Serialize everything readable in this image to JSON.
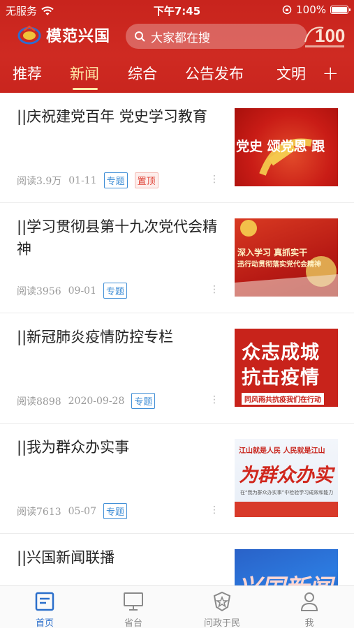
{
  "status_bar": {
    "carrier": "无服务",
    "time": "下午7:45",
    "battery": "100%"
  },
  "app": {
    "name": "模范兴国",
    "search_placeholder": "大家都在搜"
  },
  "tabs": [
    {
      "label": "推荐"
    },
    {
      "label": "新闻",
      "active": true
    },
    {
      "label": "综合"
    },
    {
      "label": "公告发布"
    },
    {
      "label": "文明"
    }
  ],
  "tab_add": "+",
  "feed": [
    {
      "title": "||庆祝建党百年  党史学习教育",
      "reads": "阅读3.9万",
      "date": "01-11",
      "badge": "专题",
      "top_badge": "置顶",
      "thumb_text": "党史  颂党恩  跟"
    },
    {
      "title": "||学习贯彻县第十九次党代会精神",
      "reads": "阅读3956",
      "date": "09-01",
      "badge": "专题",
      "thumb_text": [
        "深入学习 真抓实干",
        "迅行动贯彻落实党代会精神"
      ]
    },
    {
      "title": "||新冠肺炎疫情防控专栏",
      "reads": "阅读8898",
      "date": "2020-09-28",
      "badge": "专题",
      "thumb_text": [
        "众志成城",
        "抗击疫情",
        "同风雨共抗疫我们在行动"
      ]
    },
    {
      "title": "||我为群众办实事",
      "reads": "阅读7613",
      "date": "05-07",
      "badge": "专题",
      "thumb_text": [
        "江山就是人民 人民就是江山",
        "为群众办实",
        "在“我为群众办实事”中检验学习成效和能力"
      ]
    },
    {
      "title": "||兴国新闻联播",
      "thumb_text": "兴国新闻"
    }
  ],
  "more_label": "⋮",
  "tabbar": [
    {
      "label": "首页",
      "icon": "news-icon",
      "active": true
    },
    {
      "label": "省台",
      "icon": "monitor-icon"
    },
    {
      "label": "问政于民",
      "icon": "shield-star-icon"
    },
    {
      "label": "我",
      "icon": "person-icon"
    }
  ],
  "colors": {
    "brand_red": "#c8241d",
    "accent_gold": "#ffe9a8",
    "tab_active_blue": "#2b6fcb",
    "badge_blue": "#3f8ed6",
    "badge_red": "#e0463a"
  }
}
